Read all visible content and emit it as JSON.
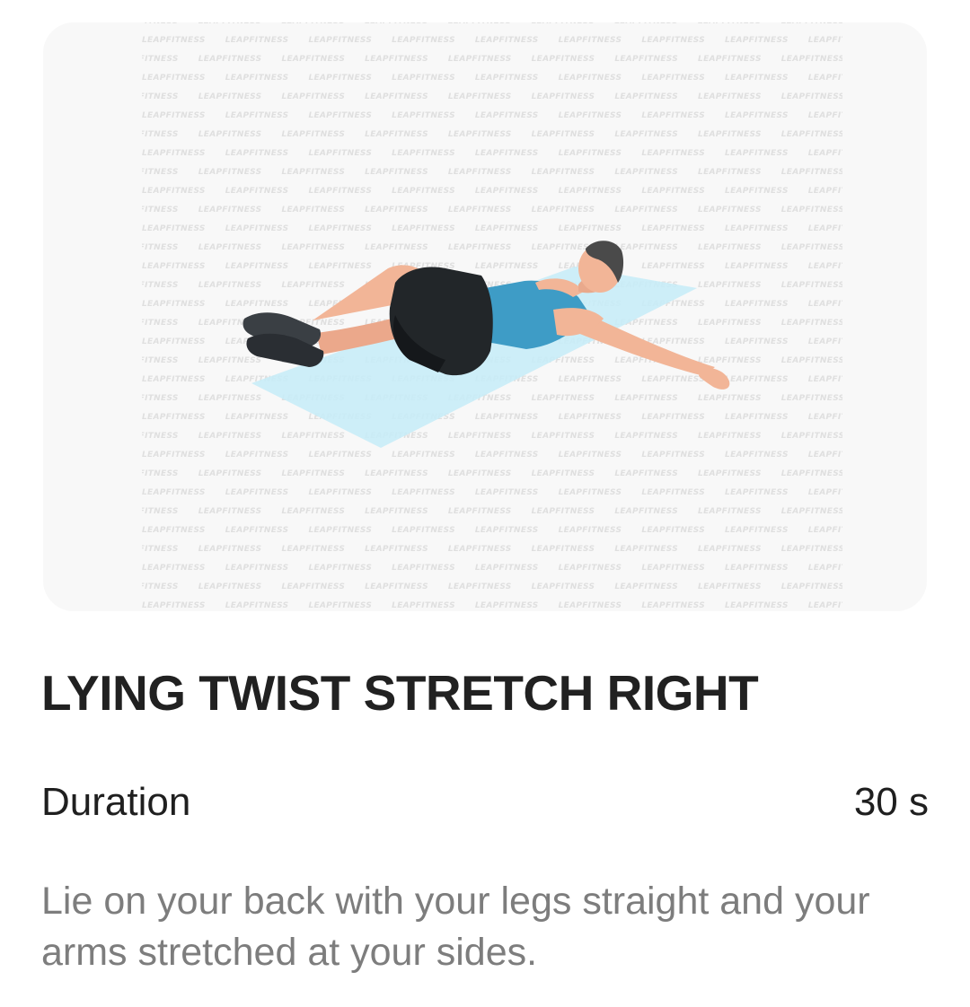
{
  "exercise": {
    "watermark_text": "LEAPFITNESS",
    "title": "LYING TWIST STRETCH RIGHT",
    "duration_label": "Duration",
    "duration_value": "30 s",
    "description": "Lie on your back with your legs straight and your arms stretched at your sides."
  },
  "colors": {
    "card_background": "#f8f8f8",
    "mat": "#c8ecf7",
    "shirt": "#3e9cc6",
    "shorts": "#222629",
    "skin": "#f2b597",
    "hair": "#4a4a4a",
    "title_text": "#212121",
    "description_text": "#7d7d7d"
  }
}
